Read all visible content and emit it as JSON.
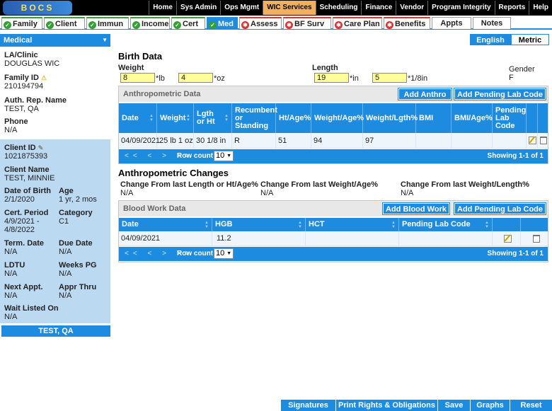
{
  "logo": {
    "text": "BOCS"
  },
  "main_nav": [
    "Home",
    "Sys Admin",
    "Ops Mgmt",
    "WIC Services",
    "Scheduling",
    "Finance",
    "Vendor",
    "Program Integrity",
    "Reports",
    "Help"
  ],
  "tabs": [
    {
      "label": "Family",
      "status": "ok"
    },
    {
      "label": "Client",
      "status": "ok"
    },
    {
      "label": "Immun",
      "status": "ok"
    },
    {
      "label": "Income",
      "status": "ok"
    },
    {
      "label": "Cert",
      "status": "ok"
    },
    {
      "label": "Med",
      "status": "ok"
    },
    {
      "label": "Assess",
      "status": "bad"
    },
    {
      "label": "BF Surv",
      "status": "bad"
    },
    {
      "label": "Care Plan",
      "status": "bad"
    },
    {
      "label": "Benefits",
      "status": "bad"
    },
    {
      "label": "Appts",
      "status": "none"
    },
    {
      "label": "Notes",
      "status": "none"
    }
  ],
  "sidebar": {
    "header": "Medical",
    "la_clinic_label": "LA/Clinic",
    "la_clinic": "DOUGLAS WIC",
    "family_id_label": "Family ID",
    "family_id": "210194794",
    "auth_rep_label": "Auth. Rep. Name",
    "auth_rep": "TEST, QA",
    "phone_label": "Phone",
    "phone": "N/A",
    "client_id_label": "Client ID",
    "client_id": "1021875393",
    "client_name_label": "Client Name",
    "client_name": "TEST, MINNIE",
    "dob_label": "Date of Birth",
    "dob": "2/1/2020",
    "age_label": "Age",
    "age": "1 yr, 2 mos",
    "cert_period_label": "Cert. Period",
    "cert_period_1": "4/9/2021 -",
    "cert_period_2": "4/8/2022",
    "category_label": "Category",
    "category": "C1",
    "term_date_label": "Term. Date",
    "term_date": "N/A",
    "due_date_label": "Due Date",
    "due_date": "N/A",
    "ldtu_label": "LDTU",
    "ldtu": "N/A",
    "weeks_pg_label": "Weeks PG",
    "weeks_pg": "N/A",
    "next_appt_label": "Next Appt.",
    "next_appt": "N/A",
    "appr_thru_label": "Appr Thru",
    "appr_thru": "N/A",
    "wait_listed_label": "Wait Listed On",
    "wait_listed": "N/A",
    "footer": "TEST, QA"
  },
  "lang": {
    "english": "English",
    "metric": "Metric"
  },
  "birth": {
    "title": "Birth Data",
    "weight_label": "Weight",
    "weight_lb": "8",
    "lb_unit": "*lb",
    "weight_oz": "4",
    "oz_unit": "*oz",
    "length_label": "Length",
    "length_in": "19",
    "in_unit": "*in",
    "length_frac": "5",
    "frac_unit": "*1/8in",
    "gender_label": "Gender",
    "gender": "F"
  },
  "anthro": {
    "title": "Anthropometric Data",
    "add_btn": "Add Anthro",
    "pending_btn": "Add Pending Lab Code",
    "columns": [
      "Date",
      "Weight",
      "Lgth or Ht",
      "Recumbent or Standing",
      "Ht/Age%",
      "Weight/Age%",
      "Weight/Lgth%",
      "BMI",
      "BMI/Age%",
      "Pending Lab Code"
    ],
    "row": {
      "date": "04/09/2021",
      "weight": "25 lb 1 oz",
      "length": "30 1/8 in",
      "recumbent": "R",
      "ht_age": "51",
      "weight_age": "94",
      "weight_lgth": "97",
      "bmi": "",
      "bmi_age": "",
      "pending": ""
    },
    "pager": {
      "nav": "<< < > >>",
      "row_count_label": "Row count:",
      "row_count": "10",
      "showing": "Showing 1-1 of 1"
    }
  },
  "changes": {
    "title": "Anthropometric Changes",
    "c1_label": "Change From last Length or Ht/Age%",
    "c1": "N/A",
    "c2_label": "Change From last Weight/Age%",
    "c2": "N/A",
    "c3_label": "Change From last Weight/Length%",
    "c3": "N/A"
  },
  "blood": {
    "title": "Blood Work Data",
    "add_btn": "Add Blood Work",
    "pending_btn": "Add Pending Lab Code",
    "columns": [
      "Date",
      "HGB",
      "HCT",
      "Pending Lab Code"
    ],
    "row": {
      "date": "04/09/2021",
      "hgb": "11.2",
      "hct": "",
      "pending": ""
    },
    "pager": {
      "nav": "<< < > >>",
      "row_count_label": "Row count:",
      "row_count": "10",
      "showing": "Showing 1-1 of 1"
    }
  },
  "footer_buttons": [
    "Signatures",
    "Print Rights & Obligations",
    "Save",
    "Graphs",
    "Reset"
  ]
}
